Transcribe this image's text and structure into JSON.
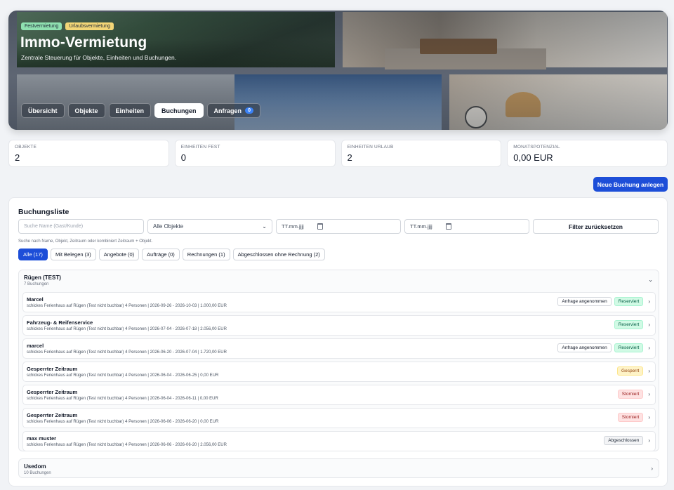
{
  "hero": {
    "badges": [
      "Festvermietung",
      "Urlaubsvermietung"
    ],
    "title": "Immo-Vermietung",
    "subtitle": "Zentrale Steuerung für Objekte, Einheiten und Buchungen.",
    "tabs": [
      {
        "label": "Übersicht",
        "active": false
      },
      {
        "label": "Objekte",
        "active": false
      },
      {
        "label": "Einheiten",
        "active": false
      },
      {
        "label": "Buchungen",
        "active": true
      },
      {
        "label": "Anfragen",
        "active": false,
        "count": "0"
      }
    ]
  },
  "stats": [
    {
      "label": "OBJEKTE",
      "value": "2"
    },
    {
      "label": "EINHEITEN FEST",
      "value": "0"
    },
    {
      "label": "EINHEITEN URLAUB",
      "value": "2"
    },
    {
      "label": "MONATSPOTENZIAL",
      "value": "0,00 EUR"
    }
  ],
  "new_booking_button": "Neue Buchung anlegen",
  "list": {
    "title": "Buchungsliste",
    "search_placeholder": "Suche Name (Gast/Kunde)",
    "object_select": "Alle Objekte",
    "date_from": "TT.mm.jjjj",
    "date_to": "TT.mm.jjjj",
    "reset_button": "Filter zurücksetzen",
    "hint": "Suche nach Name, Objekt, Zeitraum oder kombiniert Zeitraum + Objekt.",
    "chips": [
      {
        "label": "Alle (17)",
        "active": true
      },
      {
        "label": "Mit Belegen (3)",
        "active": false
      },
      {
        "label": "Angebote (0)",
        "active": false
      },
      {
        "label": "Aufträge (0)",
        "active": false
      },
      {
        "label": "Rechnungen (1)",
        "active": false
      },
      {
        "label": "Abgeschlossen ohne Rechnung (2)",
        "active": false
      }
    ],
    "groups": [
      {
        "title": "Rügen (TEST)",
        "subtitle": "7 Buchungen",
        "rows": [
          {
            "name": "Marcel",
            "detail": "schickes Ferienhaus auf Rügen (Test nicht buchbar) 4 Personen | 2026-09-26 - 2026-10-03 | 1.000,00 EUR",
            "tag": "Anfrage angenommen",
            "status": "Reserviert",
            "status_class": "reserviert"
          },
          {
            "name": "Fahrzeug- & Reifenservice",
            "detail": "schickes Ferienhaus auf Rügen (Test nicht buchbar) 4 Personen | 2026-07-04 - 2026-07-18 | 2.056,00 EUR",
            "tag": "",
            "status": "Reserviert",
            "status_class": "reserviert"
          },
          {
            "name": "marcel",
            "detail": "schickes Ferienhaus auf Rügen (Test nicht buchbar) 4 Personen | 2026-06-20 - 2026-07-04 | 1.720,00 EUR",
            "tag": "Anfrage angenommen",
            "status": "Reserviert",
            "status_class": "reserviert"
          },
          {
            "name": "Gesperrter Zeitraum",
            "detail": "schickes Ferienhaus auf Rügen (Test nicht buchbar) 4 Personen | 2026-06-04 - 2026-06-25 | 0,00 EUR",
            "tag": "",
            "status": "Gesperrt",
            "status_class": "gesperrt"
          },
          {
            "name": "Gesperrter Zeitraum",
            "detail": "schickes Ferienhaus auf Rügen (Test nicht buchbar) 4 Personen | 2026-06-04 - 2026-06-11 | 0,00 EUR",
            "tag": "",
            "status": "Storniert",
            "status_class": "storniert"
          },
          {
            "name": "Gesperrter Zeitraum",
            "detail": "schickes Ferienhaus auf Rügen (Test nicht buchbar) 4 Personen | 2026-06-06 - 2026-06-20 | 0,00 EUR",
            "tag": "",
            "status": "Storniert",
            "status_class": "storniert"
          },
          {
            "name": "max muster",
            "detail": "schickes Ferienhaus auf Rügen (Test nicht buchbar) 4 Personen | 2026-06-06 - 2026-06-20 | 2.056,00 EUR",
            "tag": "",
            "status": "Abgeschlossen",
            "status_class": "abgeschlossen"
          }
        ]
      },
      {
        "title": "Usedom",
        "subtitle": "10 Buchungen"
      }
    ]
  },
  "colors": {
    "primary": "#1d4ed8",
    "reserviert_bg": "#d1fae5",
    "gesperrt_bg": "#fef3c7",
    "storniert_bg": "#fee2e2"
  }
}
